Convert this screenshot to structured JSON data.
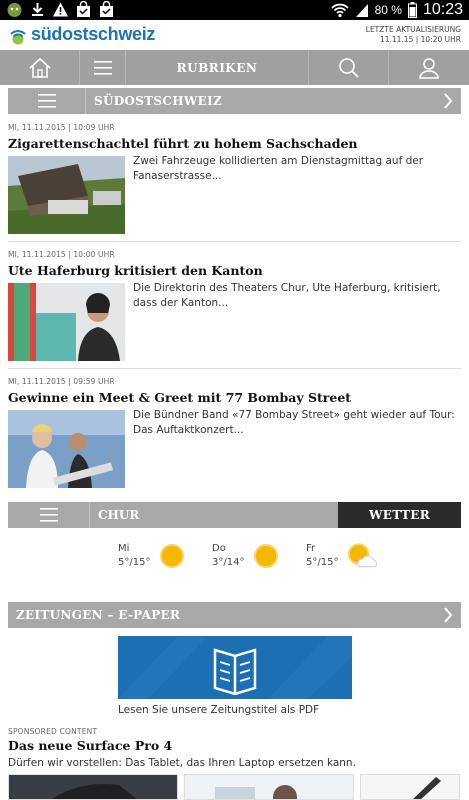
{
  "status_bar": {
    "battery": "80 %",
    "time": "10:23",
    "icons": [
      "android-robot-icon",
      "download-icon",
      "warning-icon",
      "shopping-bag-icon",
      "shopping-bag-icon",
      "wifi-icon",
      "signal-icon",
      "battery-icon"
    ]
  },
  "header": {
    "logo_text": "südostschweiz",
    "update_label": "LETZTE AKTUALISIERUNG",
    "update_time": "11.11.15 | 10:20 UHR"
  },
  "nav": {
    "rubriken_label": "RUBRIKEN",
    "icons": [
      "home-icon",
      "menu-icon",
      "search-icon",
      "user-icon"
    ]
  },
  "section": {
    "title": "SÜDOSTSCHWEIZ"
  },
  "articles": [
    {
      "meta": "MI, 11.11.2015 | 10:09 UHR",
      "headline": "Zigarettenschachtel führt zu hohem Sachschaden",
      "teaser": "Zwei Fahrzeuge kollidierten am Dienstagmittag auf der Fanaserstrasse..."
    },
    {
      "meta": "MI, 11.11.2015 | 10:00 UHR",
      "headline": "Ute Haferburg kritisiert den Kanton",
      "teaser": "Die Direktorin des Theaters Chur, Ute Haferburg, kritisiert, dass der Kanton..."
    },
    {
      "meta": "MI, 11.11.2015 | 09:59 UHR",
      "headline": "Gewinne ein Meet & Greet mit 77 Bombay Street",
      "teaser": "Die Bündner Band «77 Bombay Street» geht wieder auf Tour: Das Auftaktkonzert..."
    }
  ],
  "weather": {
    "city": "CHUR",
    "wetter_label": "WETTER",
    "days": [
      {
        "day": "Mi",
        "temps": "5°/15°",
        "icon": "sun-icon"
      },
      {
        "day": "Do",
        "temps": "3°/14°",
        "icon": "sun-icon"
      },
      {
        "day": "Fr",
        "temps": "5°/15°",
        "icon": "sun-cloud-icon"
      }
    ]
  },
  "epaper": {
    "title": "ZEITUNGEN – E-PAPER",
    "caption": "Lesen Sie unsere Zeitungstitel als PDF"
  },
  "sponsored": {
    "label": "SPONSORED CONTENT",
    "title": "Das neue Surface Pro 4",
    "teaser": "Dürfen wir vorstellen: Das Tablet, das Ihren Laptop ersetzen kann."
  },
  "colors": {
    "brand_blue": "#1d73b5",
    "logo_green": "#8dc63f",
    "nav_gray": "#a0a0a0",
    "wetter_dark": "#2b2b2b",
    "epaper_blue": "#1c6fb3"
  }
}
